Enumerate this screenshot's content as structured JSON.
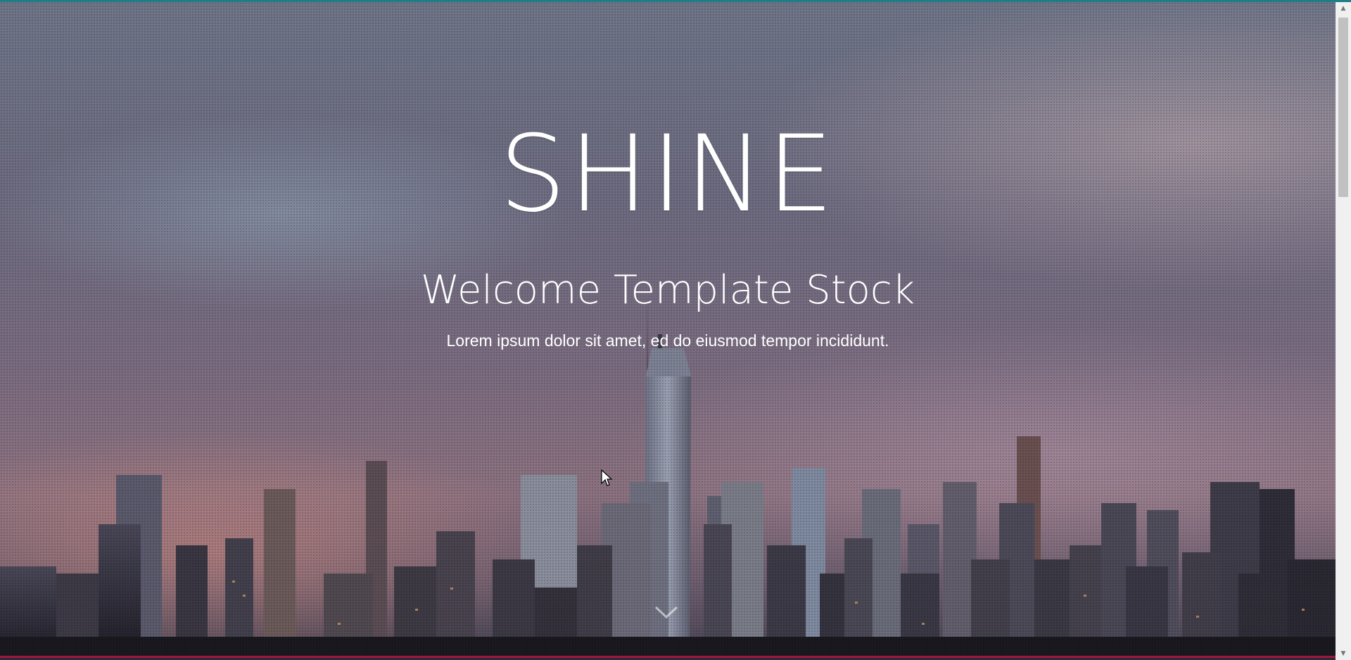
{
  "hero": {
    "title": "SHINE",
    "subtitle": "Welcome Template Stock",
    "lead": "Lorem ipsum dolor sit amet, ed do eiusmod tempor incididunt."
  },
  "colors": {
    "accent_top": "#1f7d86",
    "accent_bottom": "#a2153b",
    "text": "#ffffff"
  },
  "icons": {
    "scroll_down": "chevron-down-icon",
    "cursor": "mouse-cursor-icon"
  },
  "scrollbar": {
    "up_glyph": "▲",
    "down_glyph": "▼"
  }
}
